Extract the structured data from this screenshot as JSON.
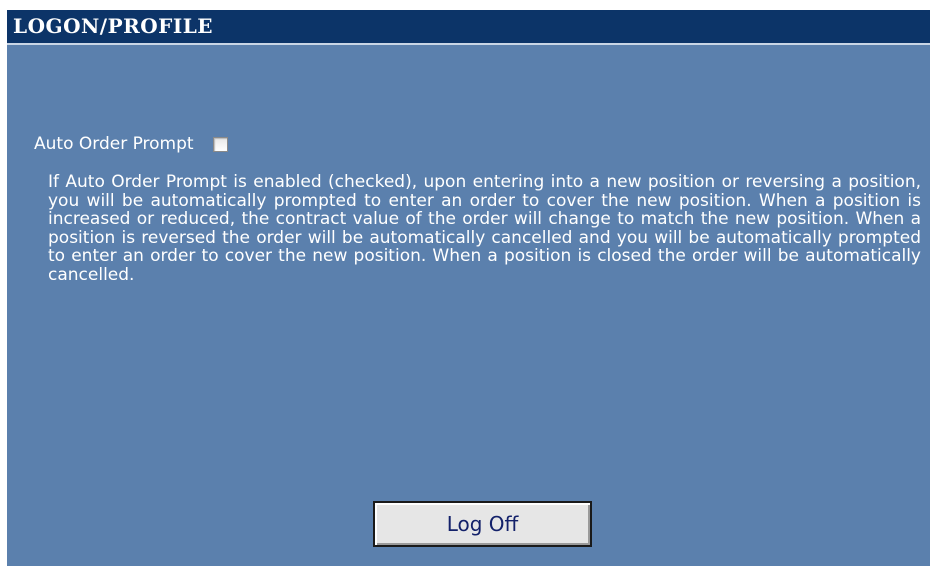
{
  "header": {
    "title": "LOGON/PROFILE"
  },
  "options": {
    "auto_order_prompt": {
      "label": "Auto Order Prompt",
      "checked": false
    }
  },
  "description": "If Auto Order Prompt is enabled (checked), upon entering into a new position or reversing a position, you will be automatically prompted to enter an order to cover the new position. When a position is increased or reduced, the contract value of the order will change to match the new position. When a position is reversed the order will be automatically cancelled and you will be automatically prompted to enter an order to cover the new position. When a position is closed the order will be automatically cancelled.",
  "actions": {
    "logoff_label": "Log Off"
  },
  "colors": {
    "title_bar": "#0c3468",
    "panel_background": "#5b80ad",
    "button_text": "#13216a"
  }
}
